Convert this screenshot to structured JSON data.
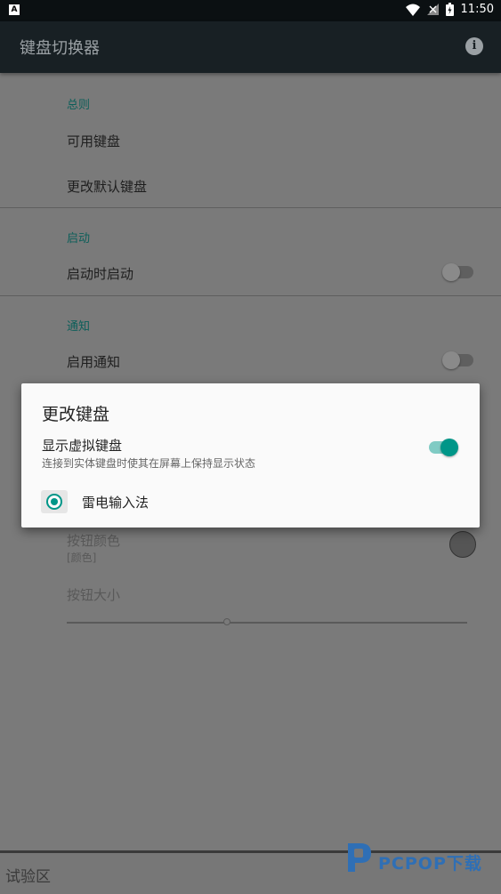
{
  "status_bar": {
    "left_badge": "A",
    "time": "11:50"
  },
  "app_bar": {
    "title": "键盘切换器",
    "info_icon": "i"
  },
  "sections": [
    {
      "header": "总则",
      "items": [
        "可用键盘",
        "更改默认键盘"
      ]
    },
    {
      "header": "启动",
      "items": [
        "启动时启动"
      ]
    },
    {
      "header": "通知",
      "items": [
        "启用通知"
      ]
    }
  ],
  "toggles": {
    "start_on_boot": false,
    "enable_notification": false,
    "show_virtual_keyboard": true
  },
  "behind_dialog": {
    "button_color_label": "按钮颜色",
    "button_color_sub": "[颜色]",
    "button_size_label": "按钮大小"
  },
  "dialog": {
    "title": "更改键盘",
    "option_title": "显示虚拟键盘",
    "option_subtitle": "连接到实体键盘时使其在屏幕上保持显示状态",
    "radio_label": "雷电输入法"
  },
  "bottom_bar": {
    "label": "试验区"
  },
  "watermark": {
    "brand": "PCPOP下载"
  },
  "colors": {
    "accent": "#009688",
    "appbar": "#182024",
    "scrim_bg": "#7a7a7a"
  }
}
